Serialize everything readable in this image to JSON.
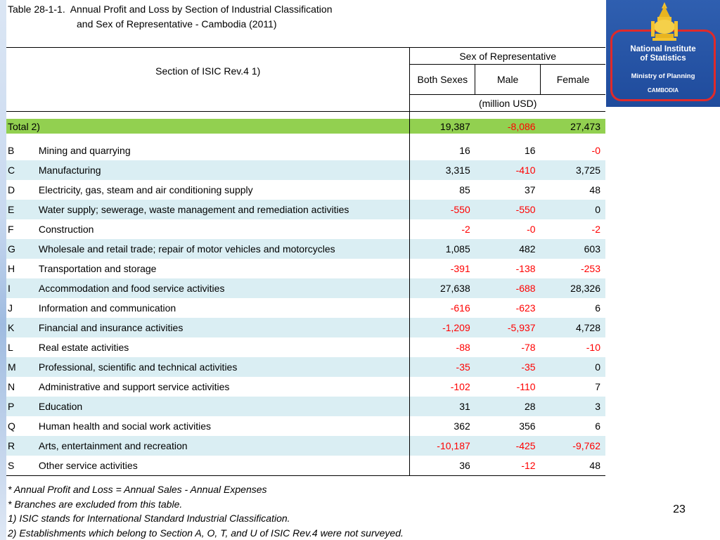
{
  "title": {
    "line1": "Table 28-1-1.  Annual Profit and Loss by Section of Industrial Classification",
    "line2": "and Sex of Representative  - Cambodia (2011)"
  },
  "header": {
    "section_label": "Section of ISIC Rev.4  1)",
    "group_label": "Sex of Representative",
    "col_both": "Both Sexes",
    "col_male": "Male",
    "col_female": "Female",
    "unit": "(million USD)"
  },
  "total": {
    "label": "Total  2)",
    "both": "19,387",
    "male": "-8,086",
    "female": "27,473"
  },
  "rows": [
    {
      "code": "B",
      "name": "Mining and quarrying",
      "both": "16",
      "male": "16",
      "female": "-0"
    },
    {
      "code": "C",
      "name": "Manufacturing",
      "both": "3,315",
      "male": "-410",
      "female": "3,725"
    },
    {
      "code": "D",
      "name": "Electricity, gas, steam and air conditioning supply",
      "both": "85",
      "male": "37",
      "female": "48"
    },
    {
      "code": "E",
      "name": "Water supply; sewerage, waste management and remediation activities",
      "both": "-550",
      "male": "-550",
      "female": "0"
    },
    {
      "code": "F",
      "name": "Construction",
      "both": "-2",
      "male": "-0",
      "female": "-2"
    },
    {
      "code": "G",
      "name": "Wholesale and retail trade; repair of motor vehicles and motorcycles",
      "both": "1,085",
      "male": "482",
      "female": "603"
    },
    {
      "code": "H",
      "name": "Transportation and storage",
      "both": "-391",
      "male": "-138",
      "female": "-253"
    },
    {
      "code": "I",
      "name": "Accommodation and food service activities",
      "both": "27,638",
      "male": "-688",
      "female": "28,326"
    },
    {
      "code": "J",
      "name": "Information and communication",
      "both": "-616",
      "male": "-623",
      "female": "6"
    },
    {
      "code": "K",
      "name": "Financial and insurance activities",
      "both": "-1,209",
      "male": "-5,937",
      "female": "4,728"
    },
    {
      "code": "L",
      "name": "Real estate activities",
      "both": "-88",
      "male": "-78",
      "female": "-10"
    },
    {
      "code": "M",
      "name": "Professional, scientific and technical activities",
      "both": "-35",
      "male": "-35",
      "female": "0"
    },
    {
      "code": "N",
      "name": "Administrative and support service activities",
      "both": "-102",
      "male": "-110",
      "female": "7"
    },
    {
      "code": "P",
      "name": "Education",
      "both": "31",
      "male": "28",
      "female": "3"
    },
    {
      "code": "Q",
      "name": "Human health and social work activities",
      "both": "362",
      "male": "356",
      "female": "6"
    },
    {
      "code": "R",
      "name": "Arts, entertainment and recreation",
      "both": "-10,187",
      "male": "-425",
      "female": "-9,762"
    },
    {
      "code": "S",
      "name": "Other service activities",
      "both": "36",
      "male": "-12",
      "female": "48"
    }
  ],
  "notes": [
    "* Annual Profit and Loss = Annual Sales - Annual Expenses",
    "* Branches are excluded from this table.",
    "1) ISIC stands for International Standard Industrial Classification.",
    "2) Establishments which belong to Section A, O, T, and U of ISIC Rev.4 were not surveyed."
  ],
  "logo": {
    "line1": "National Institute",
    "line2": "of Statistics",
    "ministry": "Ministry of Planning",
    "country": "CAMBODIA",
    "icon": "cambodia-emblem-icon"
  },
  "page_number": "23",
  "colors": {
    "total_row": "#92d050",
    "alt_row": "#daeef3",
    "negative": "#ff0000",
    "logo_bg": "#1f4b9c",
    "logo_frame": "#e02a2a"
  }
}
